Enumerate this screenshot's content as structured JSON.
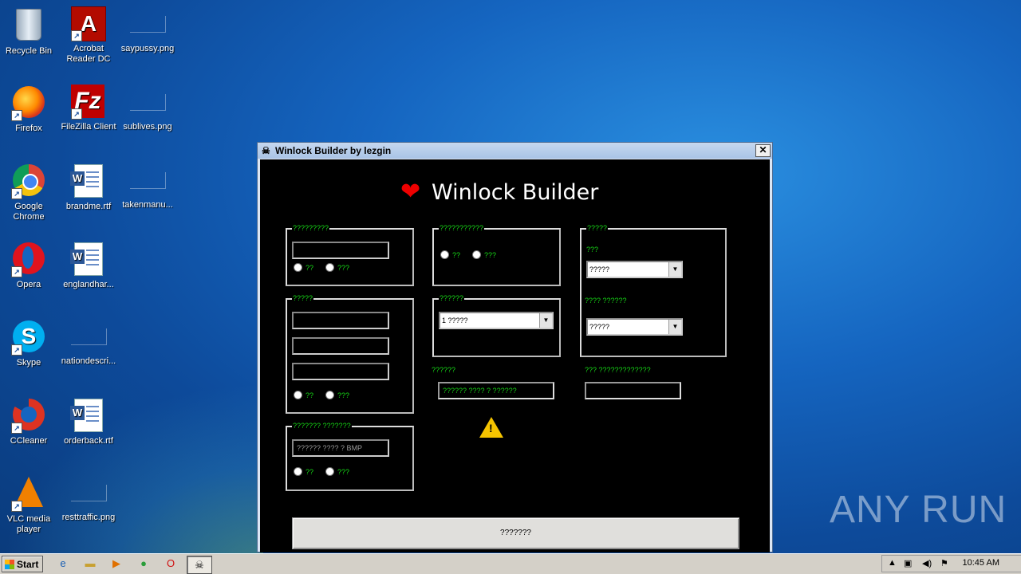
{
  "desktop": {
    "icons": [
      {
        "label": "Recycle Bin"
      },
      {
        "label": "Acrobat Reader DC"
      },
      {
        "label": "saypussy.png"
      },
      {
        "label": "Firefox"
      },
      {
        "label": "FileZilla Client"
      },
      {
        "label": "sublives.png"
      },
      {
        "label": "Google Chrome"
      },
      {
        "label": "brandme.rtf"
      },
      {
        "label": "takenmanu..."
      },
      {
        "label": "Opera"
      },
      {
        "label": "englandhar..."
      },
      {
        "label": "Skype"
      },
      {
        "label": "nationdescri..."
      },
      {
        "label": "CCleaner"
      },
      {
        "label": "orderback.rtf"
      },
      {
        "label": "VLC media player"
      },
      {
        "label": "resttraffic.png"
      }
    ],
    "watermark": "ANY RUN"
  },
  "window": {
    "title": "Winlock Builder by lezgin",
    "close_glyph": "✕",
    "heading": "Winlock Builder",
    "group1": {
      "title": "?????????",
      "radio1": "??",
      "radio2": "???"
    },
    "group2": {
      "title": "?????",
      "radio1": "??",
      "radio2": "???"
    },
    "group3": {
      "title": "??????? ???????",
      "placeholder": "?????? ???? ? BMP",
      "radio1": "??",
      "radio2": "???"
    },
    "group4": {
      "title": "???????????",
      "radio1": "??",
      "radio2": "???"
    },
    "group5": {
      "title": "??????",
      "combo_value": "1 ?????"
    },
    "group6": {
      "title": "?????",
      "label1": "???",
      "combo1_value": "?????",
      "label2": "???? ??????",
      "combo2_value": "?????"
    },
    "label_mid": "??????",
    "mid_field_value": "?????? ???? ? ??????",
    "label_right": "??? ?????????????",
    "right_field_value": "",
    "build_button": "???????"
  },
  "taskbar": {
    "start_label": "Start",
    "clock": "10:45 AM"
  }
}
